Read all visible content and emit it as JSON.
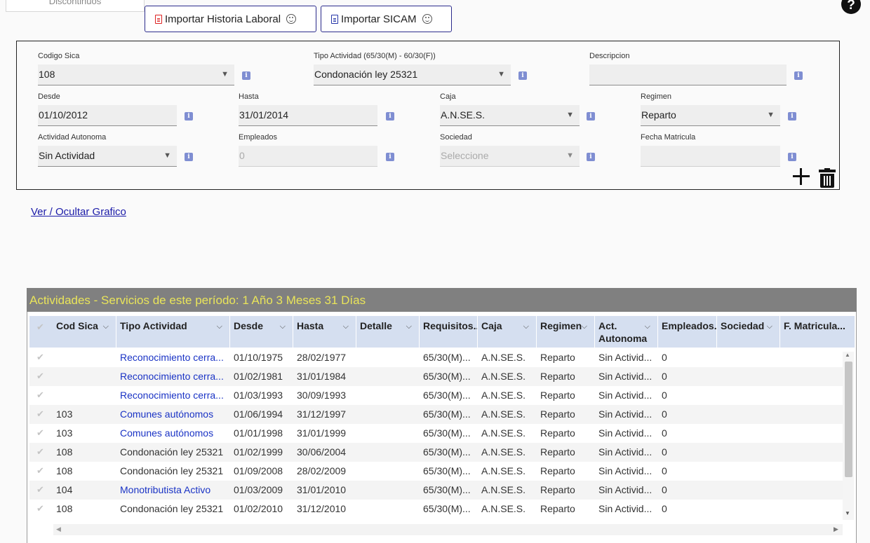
{
  "top": {
    "tab_discontinued": "Discontinuos",
    "import_hl": "Importar Historia Laboral",
    "import_sicam": "Importar SICAM",
    "help": "?"
  },
  "form": {
    "codigo_sica": {
      "label": "Codigo Sica",
      "value": "108"
    },
    "tipo_actividad": {
      "label": "Tipo Actividad (65/30(M) - 60/30(F))",
      "value": "Condonación ley 25321"
    },
    "descripcion": {
      "label": "Descripcion",
      "value": ""
    },
    "desde": {
      "label": "Desde",
      "value": "01/10/2012"
    },
    "hasta": {
      "label": "Hasta",
      "value": "31/01/2014"
    },
    "caja": {
      "label": "Caja",
      "value": "A.N.SE.S."
    },
    "regimen": {
      "label": "Regimen",
      "value": "Reparto"
    },
    "actividad_autonoma": {
      "label": "Actividad Autonoma",
      "value": "Sin Actividad"
    },
    "empleados": {
      "label": "Empleados",
      "value": "0"
    },
    "sociedad": {
      "label": "Sociedad",
      "value": "Seleccione"
    },
    "fecha_matricula": {
      "label": "Fecha Matricula",
      "value": ""
    }
  },
  "toggle_link": "Ver / Ocultar Grafico",
  "grid": {
    "title": "Actividades - Servicios de este período: 1 Año 3 Meses 31 Días",
    "check_glyph": "✔",
    "columns": [
      "Cod Sica",
      "Tipo Actividad",
      "Desde",
      "Hasta",
      "Detalle",
      "Requisitos...",
      "Caja",
      "Regimen",
      "Act. Autonoma",
      "Empleados...",
      "Sociedad",
      "F. Matricula..."
    ],
    "rows": [
      {
        "cod": "",
        "tipo": "Reconocimiento cerra...",
        "link": true,
        "desde": "01/10/1975",
        "hasta": "28/02/1977",
        "req": "65/30(M)...",
        "caja": "A.N.SE.S.",
        "regimen": "Reparto",
        "act": "Sin Activid...",
        "emp": "0"
      },
      {
        "cod": "",
        "tipo": "Reconocimiento cerra...",
        "link": true,
        "desde": "01/02/1981",
        "hasta": "31/01/1984",
        "req": "65/30(M)...",
        "caja": "A.N.SE.S.",
        "regimen": "Reparto",
        "act": "Sin Activid...",
        "emp": "0"
      },
      {
        "cod": "",
        "tipo": "Reconocimiento cerra...",
        "link": true,
        "desde": "01/03/1993",
        "hasta": "30/09/1993",
        "req": "65/30(M)...",
        "caja": "A.N.SE.S.",
        "regimen": "Reparto",
        "act": "Sin Activid...",
        "emp": "0"
      },
      {
        "cod": "103",
        "tipo": "Comunes autónomos",
        "link": true,
        "desde": "01/06/1994",
        "hasta": "31/12/1997",
        "req": "65/30(M)...",
        "caja": "A.N.SE.S.",
        "regimen": "Reparto",
        "act": "Sin Activid...",
        "emp": "0"
      },
      {
        "cod": "103",
        "tipo": "Comunes autónomos",
        "link": true,
        "desde": "01/01/1998",
        "hasta": "31/01/1999",
        "req": "65/30(M)...",
        "caja": "A.N.SE.S.",
        "regimen": "Reparto",
        "act": "Sin Activid...",
        "emp": "0"
      },
      {
        "cod": "108",
        "tipo": "Condonación ley 25321",
        "link": false,
        "desde": "01/02/1999",
        "hasta": "30/06/2004",
        "req": "65/30(M)...",
        "caja": "A.N.SE.S.",
        "regimen": "Reparto",
        "act": "Sin Activid...",
        "emp": "0"
      },
      {
        "cod": "108",
        "tipo": "Condonación ley 25321",
        "link": false,
        "desde": "01/09/2008",
        "hasta": "28/02/2009",
        "req": "65/30(M)...",
        "caja": "A.N.SE.S.",
        "regimen": "Reparto",
        "act": "Sin Activid...",
        "emp": "0"
      },
      {
        "cod": "104",
        "tipo": "Monotributista Activo",
        "link": true,
        "desde": "01/03/2009",
        "hasta": "31/01/2010",
        "req": "65/30(M)...",
        "caja": "A.N.SE.S.",
        "regimen": "Reparto",
        "act": "Sin Activid...",
        "emp": "0"
      },
      {
        "cod": "108",
        "tipo": "Condonación ley 25321",
        "link": false,
        "desde": "01/02/2010",
        "hasta": "31/12/2010",
        "req": "65/30(M)...",
        "caja": "A.N.SE.S.",
        "regimen": "Reparto",
        "act": "Sin Activid...",
        "emp": "0"
      }
    ]
  }
}
